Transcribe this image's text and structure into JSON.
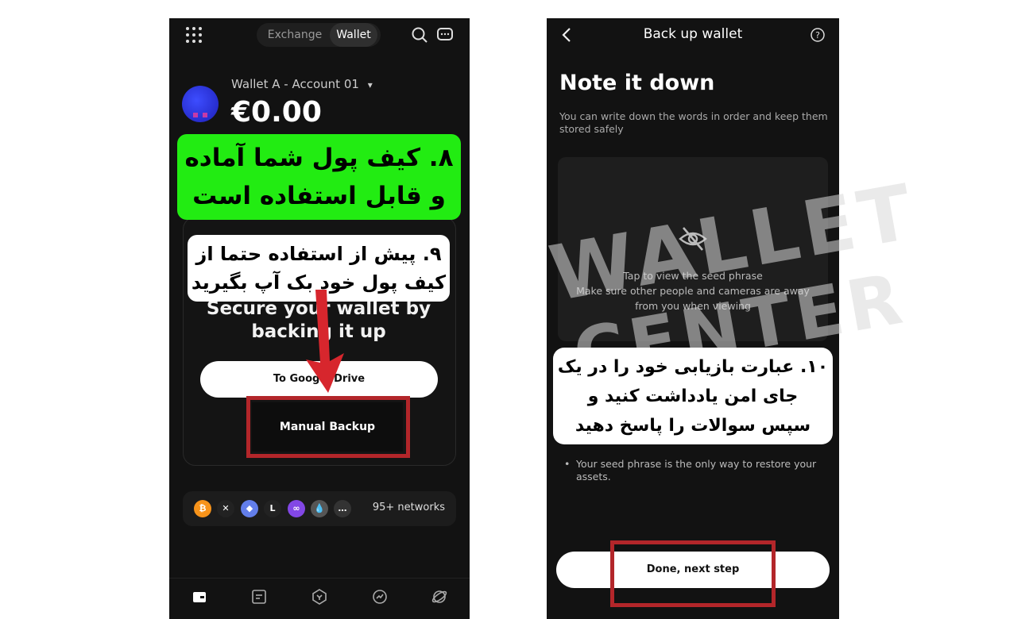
{
  "left_screen": {
    "tabs": [
      "Exchange",
      "Wallet"
    ],
    "account_label": "Wallet A - Account 01",
    "dropdown_glyph": "▾",
    "balance": "€0.00",
    "annotation_green": [
      "۸. کیف پول شما آماده",
      "و قابل استفاده است"
    ],
    "annotation_white": [
      "۹. پیش از استفاده حتما از",
      "کیف پول خود بک آپ بگیرید"
    ],
    "secure_text": [
      "Secure your wallet by",
      "backing it up"
    ],
    "google_drive_button": "To Google Drive",
    "manual_backup_button": "Manual Backup",
    "networks_label": "95+ networks",
    "coins": [
      {
        "icon": "bitcoin-icon",
        "glyph": "₿",
        "color": "#f7931a"
      },
      {
        "icon": "okx-icon",
        "glyph": "✕",
        "color": "#222222"
      },
      {
        "icon": "ethereum-icon",
        "glyph": "◆",
        "color": "#627eea"
      },
      {
        "icon": "linea-icon",
        "glyph": "L",
        "color": "#222222"
      },
      {
        "icon": "polygon-icon",
        "glyph": "∞",
        "color": "#8247e5"
      },
      {
        "icon": "sui-icon",
        "glyph": "💧",
        "color": "#555555"
      },
      {
        "icon": "more-icon",
        "glyph": "…",
        "color": "#333333"
      }
    ],
    "nav_icons": [
      "wallet-icon",
      "dapp-icon",
      "earn-icon",
      "market-icon",
      "discover-icon"
    ]
  },
  "right_screen": {
    "title": "Back up wallet",
    "heading": "Note it down",
    "subtitle": "You can write down the words in order and keep them stored safely",
    "seed_line_1": "Tap to view the seed phrase",
    "seed_line_2": "Make sure other people and cameras are away",
    "seed_line_3": "from you when viewing",
    "annotation_white": [
      "۱۰. عبارت بازیابی خود را در یک",
      "جای امن یادداشت کنید و",
      "سپس سوالات را پاسخ دهید"
    ],
    "bullet_glyph": "•",
    "bullet_text": "Your seed phrase is the only way to restore your assets.",
    "done_button": "Done, next step"
  },
  "watermark": [
    "WALLET",
    "CENTER"
  ],
  "colors": {
    "accent_green": "#22ec12",
    "highlight_red": "#b3262a",
    "phone_bg": "#121212"
  }
}
